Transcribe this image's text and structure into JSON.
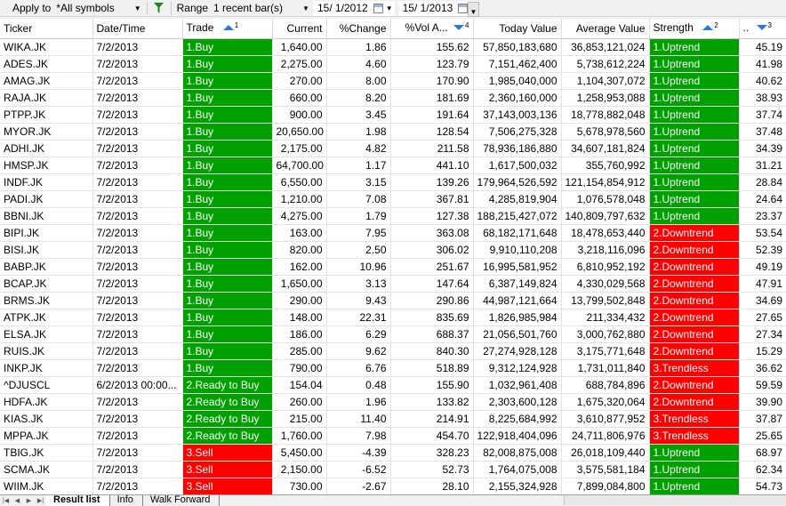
{
  "toolbar": {
    "apply_label": "Apply to",
    "symbols_value": "*All symbols",
    "range_label": "Range",
    "range_value": "1 recent bar(s)",
    "date_from": "15/ 1/2012",
    "date_to": "15/ 1/2013"
  },
  "columns": {
    "ticker": "Ticker",
    "datetime": "Date/Time",
    "trade": "Trade",
    "trade_sort": "1",
    "current": "Current",
    "change": "%Change",
    "vol": "%Vol A...",
    "vol_sort": "4",
    "today_value": "Today Value",
    "avg_value": "Average Value",
    "strength": "Strength",
    "strength_sort": "2",
    "last": "..",
    "last_sort": "3"
  },
  "rows": [
    {
      "ticker": "WIKA.JK",
      "date": "7/2/2013",
      "trade": "1.Buy",
      "current": "1,640.00",
      "change": "1.86",
      "vol": "155.62",
      "today": "57,850,183,680",
      "avg": "36,853,121,024",
      "strength": "1.Uptrend",
      "last": "45.19"
    },
    {
      "ticker": "ADES.JK",
      "date": "7/2/2013",
      "trade": "1.Buy",
      "current": "2,275.00",
      "change": "4.60",
      "vol": "123.79",
      "today": "7,151,462,400",
      "avg": "5,738,612,224",
      "strength": "1.Uptrend",
      "last": "41.98"
    },
    {
      "ticker": "AMAG.JK",
      "date": "7/2/2013",
      "trade": "1.Buy",
      "current": "270.00",
      "change": "8.00",
      "vol": "170.90",
      "today": "1,985,040,000",
      "avg": "1,104,307,072",
      "strength": "1.Uptrend",
      "last": "40.62"
    },
    {
      "ticker": "RAJA.JK",
      "date": "7/2/2013",
      "trade": "1.Buy",
      "current": "660.00",
      "change": "8.20",
      "vol": "181.69",
      "today": "2,360,160,000",
      "avg": "1,258,953,088",
      "strength": "1.Uptrend",
      "last": "38.93"
    },
    {
      "ticker": "PTPP.JK",
      "date": "7/2/2013",
      "trade": "1.Buy",
      "current": "900.00",
      "change": "3.45",
      "vol": "191.64",
      "today": "37,143,003,136",
      "avg": "18,778,882,048",
      "strength": "1.Uptrend",
      "last": "37.74"
    },
    {
      "ticker": "MYOR.JK",
      "date": "7/2/2013",
      "trade": "1.Buy",
      "current": "20,650.00",
      "change": "1.98",
      "vol": "128.54",
      "today": "7,506,275,328",
      "avg": "5,678,978,560",
      "strength": "1.Uptrend",
      "last": "37.48"
    },
    {
      "ticker": "ADHI.JK",
      "date": "7/2/2013",
      "trade": "1.Buy",
      "current": "2,175.00",
      "change": "4.82",
      "vol": "211.58",
      "today": "78,936,186,880",
      "avg": "34,607,181,824",
      "strength": "1.Uptrend",
      "last": "34.39"
    },
    {
      "ticker": "HMSP.JK",
      "date": "7/2/2013",
      "trade": "1.Buy",
      "current": "64,700.00",
      "change": "1.17",
      "vol": "441.10",
      "today": "1,617,500,032",
      "avg": "355,760,992",
      "strength": "1.Uptrend",
      "last": "31.21"
    },
    {
      "ticker": "INDF.JK",
      "date": "7/2/2013",
      "trade": "1.Buy",
      "current": "6,550.00",
      "change": "3.15",
      "vol": "139.26",
      "today": "179,964,526,592",
      "avg": "121,154,854,912",
      "strength": "1.Uptrend",
      "last": "28.84"
    },
    {
      "ticker": "PADI.JK",
      "date": "7/2/2013",
      "trade": "1.Buy",
      "current": "1,210.00",
      "change": "7.08",
      "vol": "367.81",
      "today": "4,285,819,904",
      "avg": "1,076,578,048",
      "strength": "1.Uptrend",
      "last": "24.64"
    },
    {
      "ticker": "BBNI.JK",
      "date": "7/2/2013",
      "trade": "1.Buy",
      "current": "4,275.00",
      "change": "1.79",
      "vol": "127.38",
      "today": "188,215,427,072",
      "avg": "140,809,797,632",
      "strength": "1.Uptrend",
      "last": "23.37"
    },
    {
      "ticker": "BIPI.JK",
      "date": "7/2/2013",
      "trade": "1.Buy",
      "current": "163.00",
      "change": "7.95",
      "vol": "363.08",
      "today": "68,182,171,648",
      "avg": "18,478,653,440",
      "strength": "2.Downtrend",
      "last": "53.54"
    },
    {
      "ticker": "BISI.JK",
      "date": "7/2/2013",
      "trade": "1.Buy",
      "current": "820.00",
      "change": "2.50",
      "vol": "306.02",
      "today": "9,910,110,208",
      "avg": "3,218,116,096",
      "strength": "2.Downtrend",
      "last": "52.39"
    },
    {
      "ticker": "BABP.JK",
      "date": "7/2/2013",
      "trade": "1.Buy",
      "current": "162.00",
      "change": "10.96",
      "vol": "251.67",
      "today": "16,995,581,952",
      "avg": "6,810,952,192",
      "strength": "2.Downtrend",
      "last": "49.19"
    },
    {
      "ticker": "BCAP.JK",
      "date": "7/2/2013",
      "trade": "1.Buy",
      "current": "1,650.00",
      "change": "3.13",
      "vol": "147.64",
      "today": "6,387,149,824",
      "avg": "4,330,029,568",
      "strength": "2.Downtrend",
      "last": "47.91"
    },
    {
      "ticker": "BRMS.JK",
      "date": "7/2/2013",
      "trade": "1.Buy",
      "current": "290.00",
      "change": "9.43",
      "vol": "290.86",
      "today": "44,987,121,664",
      "avg": "13,799,502,848",
      "strength": "2.Downtrend",
      "last": "34.69"
    },
    {
      "ticker": "ATPK.JK",
      "date": "7/2/2013",
      "trade": "1.Buy",
      "current": "148.00",
      "change": "22.31",
      "vol": "835.69",
      "today": "1,826,985,984",
      "avg": "211,334,432",
      "strength": "2.Downtrend",
      "last": "27.65"
    },
    {
      "ticker": "ELSA.JK",
      "date": "7/2/2013",
      "trade": "1.Buy",
      "current": "186.00",
      "change": "6.29",
      "vol": "688.37",
      "today": "21,056,501,760",
      "avg": "3,000,762,880",
      "strength": "2.Downtrend",
      "last": "27.34"
    },
    {
      "ticker": "RUIS.JK",
      "date": "7/2/2013",
      "trade": "1.Buy",
      "current": "285.00",
      "change": "9.62",
      "vol": "840.30",
      "today": "27,274,928,128",
      "avg": "3,175,771,648",
      "strength": "2.Downtrend",
      "last": "15.29"
    },
    {
      "ticker": "INKP.JK",
      "date": "7/2/2013",
      "trade": "1.Buy",
      "current": "790.00",
      "change": "6.76",
      "vol": "518.89",
      "today": "9,312,124,928",
      "avg": "1,731,011,840",
      "strength": "3.Trendless",
      "last": "36.62"
    },
    {
      "ticker": "^DJUSCL",
      "date": "6/2/2013 00:00...",
      "trade": "2.Ready to Buy",
      "current": "154.04",
      "change": "0.48",
      "vol": "155.90",
      "today": "1,032,961,408",
      "avg": "688,784,896",
      "strength": "2.Downtrend",
      "last": "59.59"
    },
    {
      "ticker": "HDFA.JK",
      "date": "7/2/2013",
      "trade": "2.Ready to Buy",
      "current": "260.00",
      "change": "1.96",
      "vol": "133.82",
      "today": "2,303,600,128",
      "avg": "1,675,320,064",
      "strength": "2.Downtrend",
      "last": "39.90"
    },
    {
      "ticker": "KIAS.JK",
      "date": "7/2/2013",
      "trade": "2.Ready to Buy",
      "current": "215.00",
      "change": "11.40",
      "vol": "214.91",
      "today": "8,225,684,992",
      "avg": "3,610,877,952",
      "strength": "3.Trendless",
      "last": "37.87"
    },
    {
      "ticker": "MPPA.JK",
      "date": "7/2/2013",
      "trade": "2.Ready to Buy",
      "current": "1,760.00",
      "change": "7.98",
      "vol": "454.70",
      "today": "122,918,404,096",
      "avg": "24,711,806,976",
      "strength": "3.Trendless",
      "last": "25.65"
    },
    {
      "ticker": "TBIG.JK",
      "date": "7/2/2013",
      "trade": "3.Sell",
      "current": "5,450.00",
      "change": "-4.39",
      "vol": "328.23",
      "today": "82,008,875,008",
      "avg": "26,018,109,440",
      "strength": "1.Uptrend",
      "last": "68.97"
    },
    {
      "ticker": "SCMA.JK",
      "date": "7/2/2013",
      "trade": "3.Sell",
      "current": "2,150.00",
      "change": "-6.52",
      "vol": "52.73",
      "today": "1,764,075,008",
      "avg": "3,575,581,184",
      "strength": "1.Uptrend",
      "last": "62.34"
    },
    {
      "ticker": "WIIM.JK",
      "date": "7/2/2013",
      "trade": "3.Sell",
      "current": "730.00",
      "change": "-2.67",
      "vol": "28.10",
      "today": "2,155,324,928",
      "avg": "7,899,084,800",
      "strength": "1.Uptrend",
      "last": "54.73"
    }
  ],
  "tabs": [
    "Result list",
    "Info",
    "Walk Forward"
  ],
  "colors": {
    "green": "#00a000",
    "red": "#ff0000"
  }
}
